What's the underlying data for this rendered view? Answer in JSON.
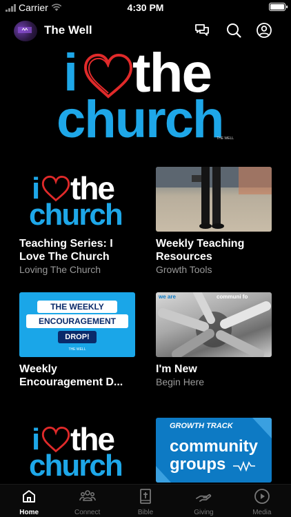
{
  "status_bar": {
    "carrier": "Carrier",
    "time": "4:30 PM"
  },
  "header": {
    "title": "The Well",
    "icons": [
      "chat-icon",
      "search-icon",
      "profile-icon"
    ]
  },
  "hero": {
    "logo_i": "i",
    "logo_the": "the",
    "logo_church": "church",
    "logo_mark": "THE WELL"
  },
  "cards": [
    {
      "title": "Teaching Series: I Love The Church",
      "subtitle": "Loving The Church",
      "thumb": "i-love-the-church"
    },
    {
      "title": "Weekly Teaching Resources",
      "subtitle": "Growth Tools",
      "thumb": "photo-person-standing"
    },
    {
      "title": "Weekly Encouragement D...",
      "subtitle": "",
      "thumb": "weekly-encouragement",
      "thumb_text": {
        "line1": "THE WEEKLY",
        "line2": "ENCOURAGEMENT",
        "line3": "DROP!",
        "brand": "THE WELL"
      }
    },
    {
      "title": "I'm New",
      "subtitle": "Begin Here",
      "thumb": "hands-together",
      "thumb_text": {
        "left": "we are",
        "right": "communi  fo"
      }
    },
    {
      "title": "",
      "subtitle": "",
      "thumb": "i-love-the-church"
    },
    {
      "title": "",
      "subtitle": "",
      "thumb": "community-groups",
      "thumb_text": {
        "top": "GROWTH TRACK",
        "main1": "community",
        "main2": "groups"
      }
    }
  ],
  "tabs": [
    {
      "label": "Home",
      "icon": "home-icon",
      "active": true
    },
    {
      "label": "Connect",
      "icon": "people-icon",
      "active": false
    },
    {
      "label": "Bible",
      "icon": "bible-icon",
      "active": false
    },
    {
      "label": "Giving",
      "icon": "giving-hand-icon",
      "active": false
    },
    {
      "label": "Media",
      "icon": "play-circle-icon",
      "active": false
    }
  ],
  "colors": {
    "accent": "#1ea7e8",
    "heart": "#e02a2a",
    "background": "#000000",
    "groups_blue": "#0d7ac4",
    "navy": "#0a2a6a"
  }
}
